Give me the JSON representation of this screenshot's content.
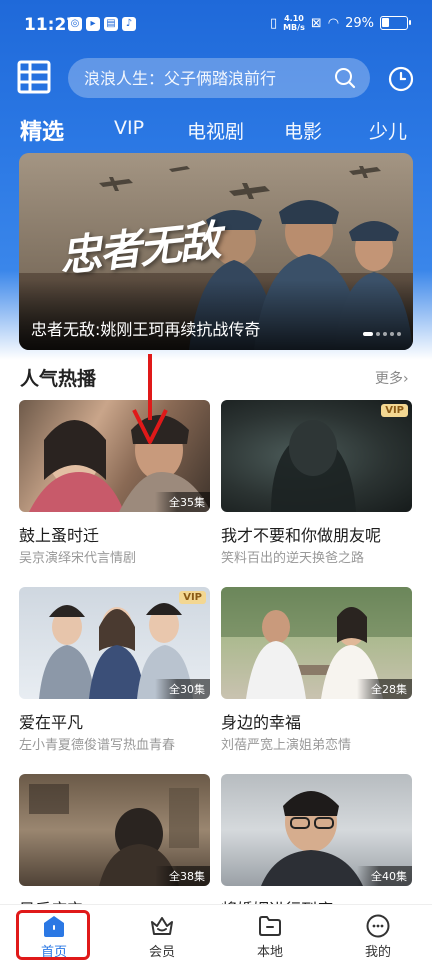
{
  "status_bar": {
    "time": "11:27",
    "net_speed_value": "4.10",
    "net_speed_unit": "MB/s",
    "battery": "29%"
  },
  "search": {
    "placeholder": "浪浪人生：父子俩踏浪前行"
  },
  "tabs": [
    {
      "label": "精选",
      "active": true
    },
    {
      "label": "VIP"
    },
    {
      "label": "电视剧"
    },
    {
      "label": "电影"
    },
    {
      "label": "少儿"
    }
  ],
  "banner": {
    "logo_text": "忠者无敌",
    "caption": "忠者无敌:姚刚王珂再续抗战传奇"
  },
  "section": {
    "title": "人气热播",
    "more": "更多"
  },
  "cards": [
    {
      "title": "鼓上蚤时迁",
      "desc": "吴京演绎宋代言情剧",
      "count": "全35集"
    },
    {
      "title": "我才不要和你做朋友呢",
      "desc": "笑料百出的逆天换爸之路",
      "vip": "VIP"
    },
    {
      "title": "爱在平凡",
      "desc": "左小青夏德俊谱写热血青春",
      "count": "全30集",
      "vip": "VIP"
    },
    {
      "title": "身边的幸福",
      "desc": "刘蓓严宽上演姐弟恋情",
      "count": "全28集"
    },
    {
      "title": "风后庄宝",
      "desc": "",
      "count": "全38集"
    },
    {
      "title": "将婚姻进行到底",
      "desc": "",
      "count": "全40集"
    }
  ],
  "bottom_nav": [
    {
      "label": "首页",
      "active": true
    },
    {
      "label": "会员"
    },
    {
      "label": "本地"
    },
    {
      "label": "我的"
    }
  ],
  "colors": {
    "accent": "#2b78e4",
    "annotation": "#e01919",
    "vip_bg": "#f3d792"
  }
}
